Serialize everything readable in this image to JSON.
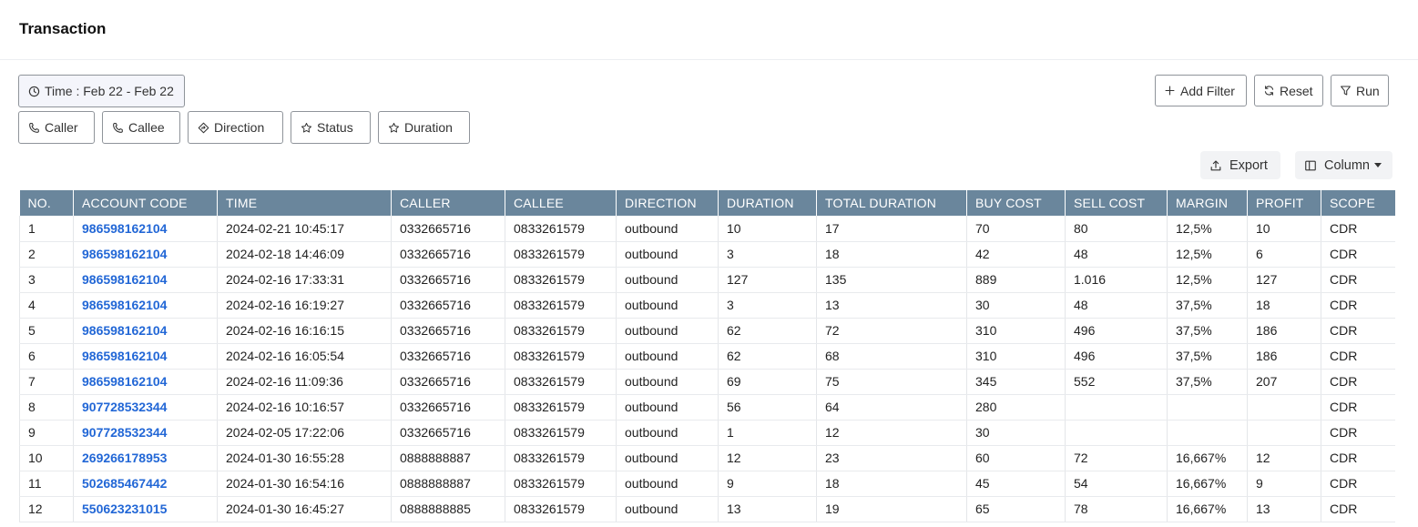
{
  "header": {
    "title": "Transaction"
  },
  "filters": {
    "time": "Time : Feb 22 - Feb 22",
    "caller": "Caller",
    "callee": "Callee",
    "direction": "Direction",
    "status": "Status",
    "duration": "Duration"
  },
  "actions": {
    "add_filter": "Add Filter",
    "reset": "Reset",
    "run": "Run"
  },
  "toolbar": {
    "export": "Export",
    "column": "Column"
  },
  "table": {
    "columns": [
      "NO.",
      "ACCOUNT CODE",
      "TIME",
      "CALLER",
      "CALLEE",
      "DIRECTION",
      "DURATION",
      "TOTAL DURATION",
      "BUY COST",
      "SELL COST",
      "MARGIN",
      "PROFIT",
      "SCOPE"
    ],
    "rows": [
      [
        "1",
        "986598162104",
        "2024-02-21 10:45:17",
        "0332665716",
        "0833261579",
        "outbound",
        "10",
        "17",
        "70",
        "80",
        "12,5%",
        "10",
        "CDR"
      ],
      [
        "2",
        "986598162104",
        "2024-02-18 14:46:09",
        "0332665716",
        "0833261579",
        "outbound",
        "3",
        "18",
        "42",
        "48",
        "12,5%",
        "6",
        "CDR"
      ],
      [
        "3",
        "986598162104",
        "2024-02-16 17:33:31",
        "0332665716",
        "0833261579",
        "outbound",
        "127",
        "135",
        "889",
        "1.016",
        "12,5%",
        "127",
        "CDR"
      ],
      [
        "4",
        "986598162104",
        "2024-02-16 16:19:27",
        "0332665716",
        "0833261579",
        "outbound",
        "3",
        "13",
        "30",
        "48",
        "37,5%",
        "18",
        "CDR"
      ],
      [
        "5",
        "986598162104",
        "2024-02-16 16:16:15",
        "0332665716",
        "0833261579",
        "outbound",
        "62",
        "72",
        "310",
        "496",
        "37,5%",
        "186",
        "CDR"
      ],
      [
        "6",
        "986598162104",
        "2024-02-16 16:05:54",
        "0332665716",
        "0833261579",
        "outbound",
        "62",
        "68",
        "310",
        "496",
        "37,5%",
        "186",
        "CDR"
      ],
      [
        "7",
        "986598162104",
        "2024-02-16 11:09:36",
        "0332665716",
        "0833261579",
        "outbound",
        "69",
        "75",
        "345",
        "552",
        "37,5%",
        "207",
        "CDR"
      ],
      [
        "8",
        "907728532344",
        "2024-02-16 10:16:57",
        "0332665716",
        "0833261579",
        "outbound",
        "56",
        "64",
        "280",
        "",
        "",
        "",
        "CDR"
      ],
      [
        "9",
        "907728532344",
        "2024-02-05 17:22:06",
        "0332665716",
        "0833261579",
        "outbound",
        "1",
        "12",
        "30",
        "",
        "",
        "",
        "CDR"
      ],
      [
        "10",
        "269266178953",
        "2024-01-30 16:55:28",
        "0888888887",
        "0833261579",
        "outbound",
        "12",
        "23",
        "60",
        "72",
        "16,667%",
        "12",
        "CDR"
      ],
      [
        "11",
        "502685467442",
        "2024-01-30 16:54:16",
        "0888888887",
        "0833261579",
        "outbound",
        "9",
        "18",
        "45",
        "54",
        "16,667%",
        "9",
        "CDR"
      ],
      [
        "12",
        "550623231015",
        "2024-01-30 16:45:27",
        "0888888885",
        "0833261579",
        "outbound",
        "13",
        "19",
        "65",
        "78",
        "16,667%",
        "13",
        "CDR"
      ]
    ]
  }
}
